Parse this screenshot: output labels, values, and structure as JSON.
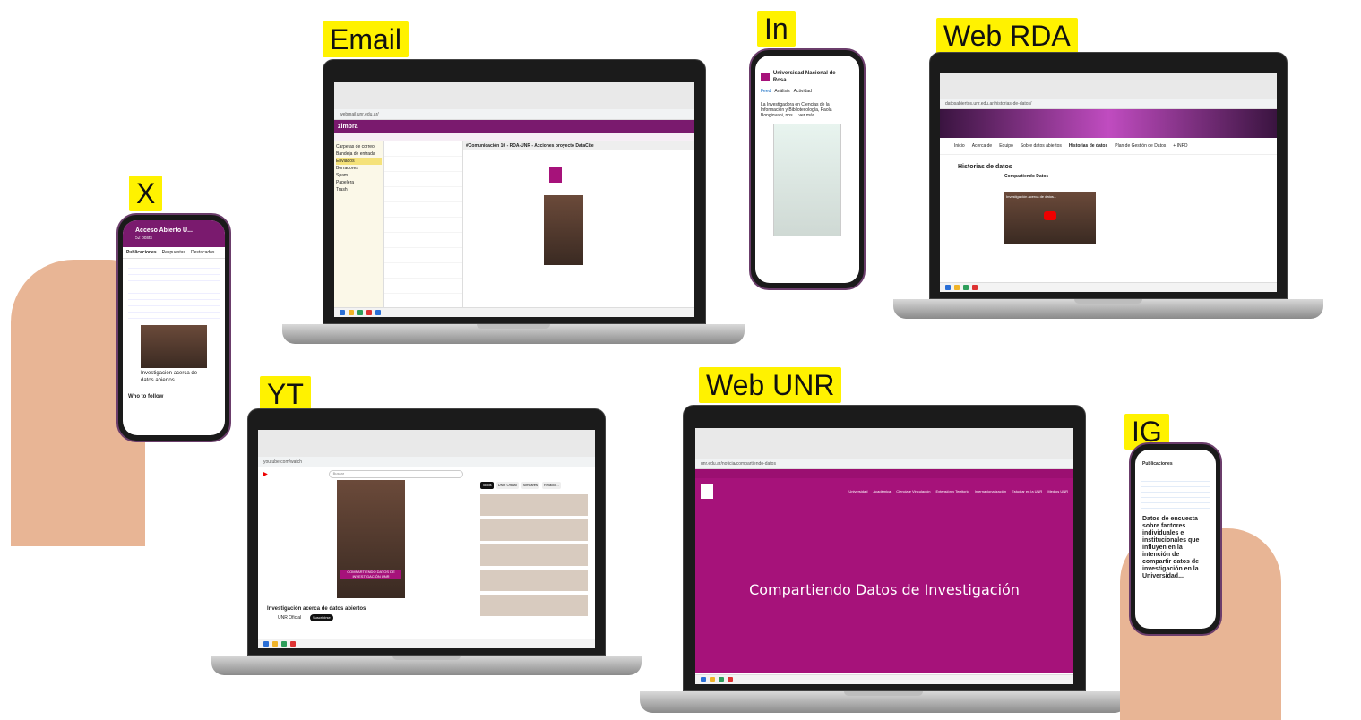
{
  "labels": {
    "email": "Email",
    "in": "In",
    "web_rda": "Web RDA",
    "x": "X",
    "yt": "YT",
    "web_unr": "Web UNR",
    "ig": "IG"
  },
  "email_screen": {
    "subject": "#Comunicación 10 - RDA-UNR - Acciones proyecto DataCite",
    "folders": [
      "Carpetas de correo",
      "Bandeja de entrada",
      "Enviados",
      "Borradores",
      "Spam",
      "Papelera",
      "Trash"
    ]
  },
  "linkedin_screen": {
    "org_name": "Universidad Nacional de Rosa...",
    "post_text": "La Investigadora en Ciencias de la Información y Bibliotecología, Paola Bongiovani, nos ... ver más",
    "tabs": [
      "Feed",
      "Análisis",
      "Actividad"
    ]
  },
  "rda_screen": {
    "nav": [
      "Inicio",
      "Acerca de",
      "Equipo",
      "Sobre datos abiertos",
      "Historias de datos",
      "Plan de Gestión de Datos",
      "+ INFO"
    ],
    "section": "Historias de datos",
    "subsection": "Compartiendo Datos",
    "video_title": "Investigación acerca de datos..."
  },
  "x_screen": {
    "header": "Acceso Abierto U...",
    "posts_count": "52 posts",
    "tabs": [
      "Publicaciones",
      "Respuestas",
      "Destacados"
    ],
    "card_title": "Investigación acerca de datos abiertos",
    "who_to_follow": "Who to follow"
  },
  "yt_screen": {
    "search_placeholder": "Buscar",
    "video_title": "Investigación acerca de datos abiertos",
    "channel": "UNR Oficial",
    "subscribe": "Suscribirse",
    "overlay": "COMPARTIENDO DATOS DE INVESTIGACIÓN UNR",
    "chips": [
      "Todos",
      "UNR Oficial",
      "Similares",
      "Relacio..."
    ]
  },
  "unr_screen": {
    "hero_title": "Compartiendo Datos de Investigación",
    "nav": [
      "Universidad",
      "Académica",
      "Ciencia e Vinculación",
      "Extensión y Territorio",
      "Internacionalización",
      "Estudiar en la UNR",
      "Medios UNR"
    ]
  },
  "ig_screen": {
    "header": "Publicaciones",
    "headline": "Datos de encuesta sobre factores individuales e institucionales que influyen en la intención de compartir datos de investigación en la Universidad..."
  }
}
